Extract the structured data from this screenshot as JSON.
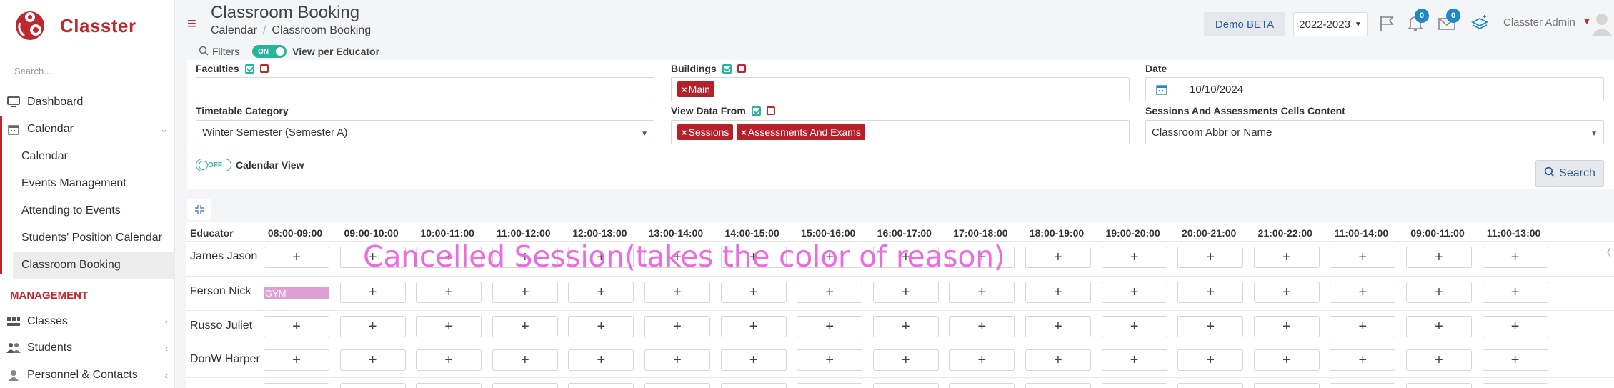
{
  "brand": {
    "name": "Classter",
    "accent": "#c0262d"
  },
  "sidebar": {
    "search_placeholder": "Search...",
    "dashboard": "Dashboard",
    "calendar": {
      "label": "Calendar",
      "items": [
        "Calendar",
        "Events Management",
        "Attending to Events",
        "Students' Position Calendar",
        "Classroom Booking"
      ],
      "active": "Classroom Booking"
    },
    "section_management": "MANAGEMENT",
    "management_items": [
      "Classes",
      "Students",
      "Personnel & Contacts"
    ]
  },
  "header": {
    "title": "Classroom Booking",
    "breadcrumb": [
      "Calendar",
      "Classroom Booking"
    ],
    "demo_button": "Demo BETA",
    "year": "2022-2023",
    "notifications_count": "0",
    "messages_count": "0",
    "user": "Classter Admin"
  },
  "filters": {
    "toggle_label": "Filters",
    "view_toggle_state": "ON",
    "view_toggle_label": "View per Educator",
    "faculties_label": "Faculties",
    "buildings_label": "Buildings",
    "buildings_tags": [
      "Main"
    ],
    "date_label": "Date",
    "date_value": "10/10/2024",
    "timetable_category_label": "Timetable Category",
    "timetable_category_value": "Winter Semester (Semester A)",
    "view_data_from_label": "View Data From",
    "view_data_from_tags": [
      "Sessions",
      "Assessments And Exams"
    ],
    "cells_content_label": "Sessions And Assessments Cells Content",
    "cells_content_value": "Classroom Abbr or Name",
    "calendar_view_state": "OFF",
    "calendar_view_label": "Calendar View",
    "search_button": "Search"
  },
  "grid": {
    "educator_header": "Educator",
    "time_slots": [
      "08:00-09:00",
      "09:00-10:00",
      "10:00-11:00",
      "11:00-12:00",
      "12:00-13:00",
      "13:00-14:00",
      "14:00-15:00",
      "15:00-16:00",
      "16:00-17:00",
      "17:00-18:00",
      "18:00-19:00",
      "19:00-20:00",
      "20:00-21:00",
      "21:00-22:00",
      "11:00-14:00",
      "09:00-11:00",
      "11:00-13:00"
    ],
    "educators": [
      "James Jason",
      "Ferson Nick",
      "Russo Juliet",
      "DonW Harper"
    ],
    "empty_cell_symbol": "+",
    "cancelled_session_label": "GYM",
    "cancelled_session_color": "#de9fd3"
  },
  "annotation": {
    "text": "Cancelled Session(takes the color of reason)",
    "color": "#ec6be1"
  }
}
